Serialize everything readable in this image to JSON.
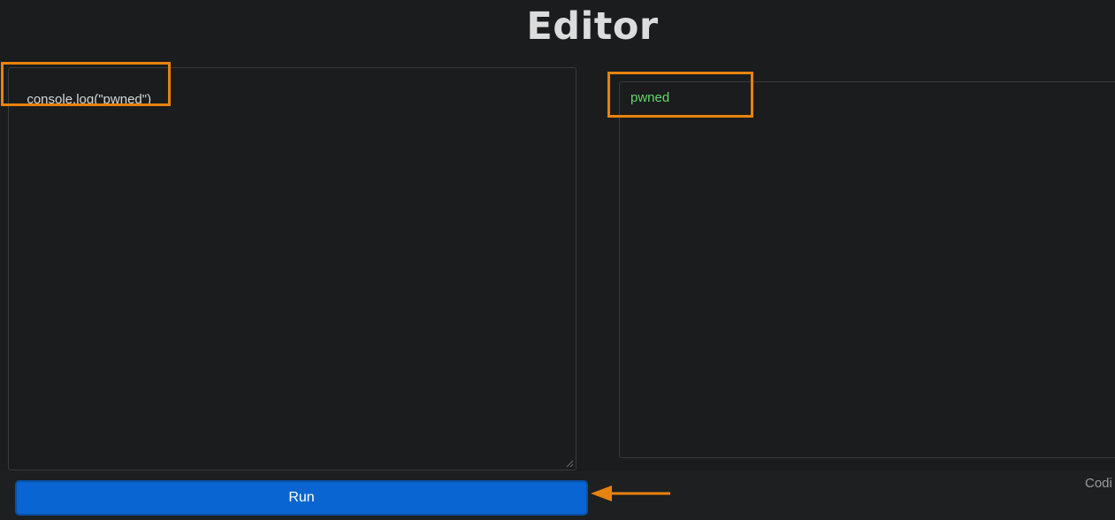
{
  "page": {
    "title": "Editor"
  },
  "editor": {
    "code": "console.log(\"pwned\")"
  },
  "output": {
    "lines": [
      "pwned"
    ]
  },
  "controls": {
    "run_label": "Run"
  },
  "footer": {
    "text": "Codi"
  },
  "annotations": {
    "highlight_color": "#e8820e",
    "arrow_color": "#e8820e"
  },
  "colors": {
    "background": "#1b1c1e",
    "run_button": "#0865d1",
    "output_text": "#67d86a"
  }
}
